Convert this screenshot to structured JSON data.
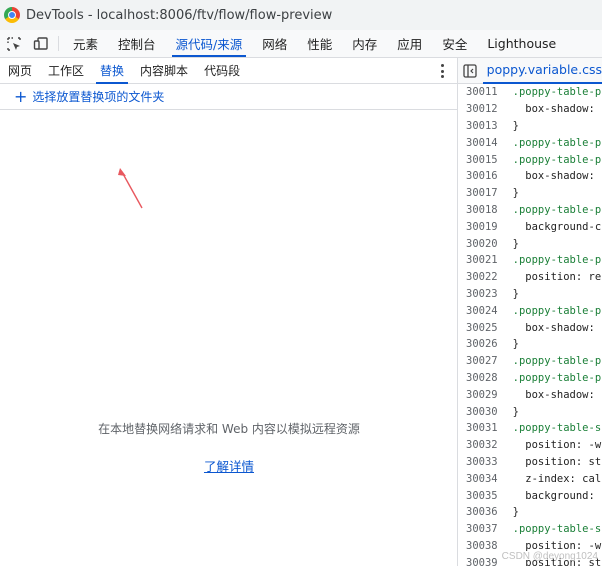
{
  "window": {
    "title": "DevTools - localhost:8006/ftv/flow/flow-preview"
  },
  "toolbar": {
    "tabs": [
      {
        "label": "元素",
        "active": false
      },
      {
        "label": "控制台",
        "active": false
      },
      {
        "label": "源代码/来源",
        "active": true
      },
      {
        "label": "网络",
        "active": false
      },
      {
        "label": "性能",
        "active": false
      },
      {
        "label": "内存",
        "active": false
      },
      {
        "label": "应用",
        "active": false
      },
      {
        "label": "安全",
        "active": false
      },
      {
        "label": "Lighthouse",
        "active": false
      }
    ]
  },
  "sources": {
    "subtabs": [
      {
        "label": "网页",
        "active": false
      },
      {
        "label": "工作区",
        "active": false
      },
      {
        "label": "替换",
        "active": true
      },
      {
        "label": "内容脚本",
        "active": false
      },
      {
        "label": "代码段",
        "active": false
      }
    ],
    "select_folder_label": "选择放置替换项的文件夹",
    "empty_message": "在本地替换网络请求和 Web 内容以模拟远程资源",
    "learn_more": "了解详情"
  },
  "editor": {
    "file_tab": "poppy.variable.css",
    "lines": [
      {
        "num": "30011",
        "text": "  .poppy-table-p",
        "kind": "selector"
      },
      {
        "num": "30012",
        "text": "    box-shadow:",
        "kind": "prop"
      },
      {
        "num": "30013",
        "text": "  }",
        "kind": "brace"
      },
      {
        "num": "30014",
        "text": "  .poppy-table-p",
        "kind": "selector"
      },
      {
        "num": "30015",
        "text": "  .poppy-table-p",
        "kind": "selector"
      },
      {
        "num": "30016",
        "text": "    box-shadow:",
        "kind": "prop"
      },
      {
        "num": "30017",
        "text": "  }",
        "kind": "brace"
      },
      {
        "num": "30018",
        "text": "  .poppy-table-p",
        "kind": "selector"
      },
      {
        "num": "30019",
        "text": "    background-c",
        "kind": "prop"
      },
      {
        "num": "30020",
        "text": "  }",
        "kind": "brace"
      },
      {
        "num": "30021",
        "text": "  .poppy-table-p",
        "kind": "selector"
      },
      {
        "num": "30022",
        "text": "    position: re",
        "kind": "prop"
      },
      {
        "num": "30023",
        "text": "  }",
        "kind": "brace"
      },
      {
        "num": "30024",
        "text": "  .poppy-table-p",
        "kind": "selector"
      },
      {
        "num": "30025",
        "text": "    box-shadow:",
        "kind": "prop"
      },
      {
        "num": "30026",
        "text": "  }",
        "kind": "brace"
      },
      {
        "num": "30027",
        "text": "  .poppy-table-p",
        "kind": "selector"
      },
      {
        "num": "30028",
        "text": "  .poppy-table-p",
        "kind": "selector"
      },
      {
        "num": "30029",
        "text": "    box-shadow:",
        "kind": "prop"
      },
      {
        "num": "30030",
        "text": "  }",
        "kind": "brace"
      },
      {
        "num": "30031",
        "text": "  .poppy-table-s",
        "kind": "selector"
      },
      {
        "num": "30032",
        "text": "    position: -w",
        "kind": "prop"
      },
      {
        "num": "30033",
        "text": "    position: st",
        "kind": "prop"
      },
      {
        "num": "30034",
        "text": "    z-index: cal",
        "kind": "prop"
      },
      {
        "num": "30035",
        "text": "    background:",
        "kind": "prop"
      },
      {
        "num": "30036",
        "text": "  }",
        "kind": "brace"
      },
      {
        "num": "30037",
        "text": "  .poppy-table-s",
        "kind": "selector"
      },
      {
        "num": "30038",
        "text": "    position: -w",
        "kind": "prop"
      },
      {
        "num": "30039",
        "text": "    position: st",
        "kind": "prop"
      }
    ]
  },
  "watermark": "CSDN @deyong1024",
  "colors": {
    "accent": "#0b57d0",
    "annotation_arrow": "#e8585f",
    "selector": "#1a7f37"
  }
}
